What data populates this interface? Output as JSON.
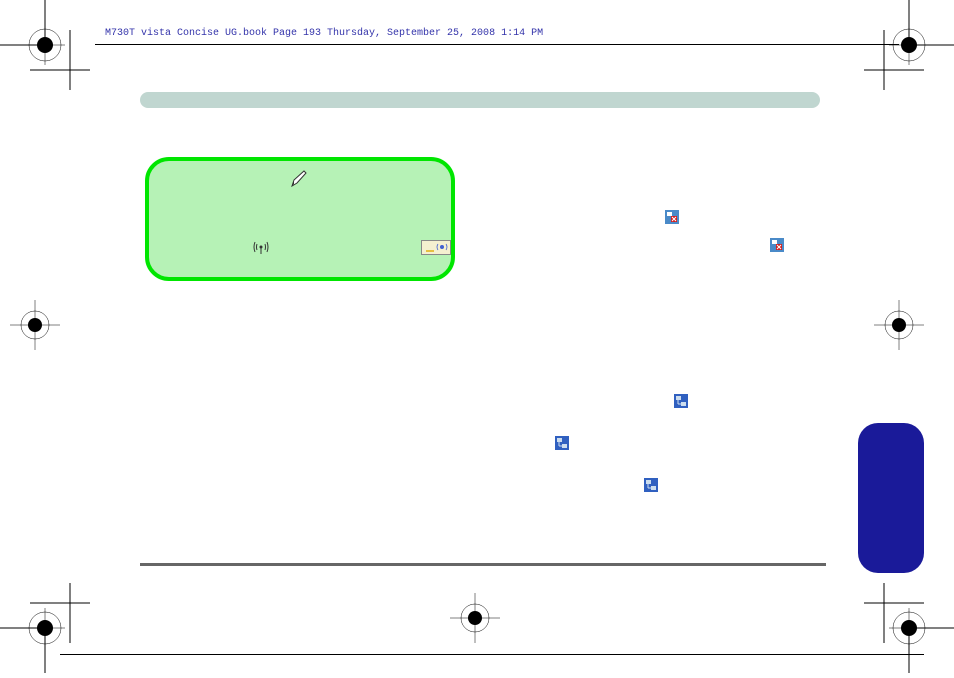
{
  "header": {
    "book_info": "M730T vista Concise UG.book  Page 193  Thursday, September 25, 2008  1:14 PM"
  },
  "icons": {
    "pen": "pen-icon",
    "antenna": "antenna-icon",
    "wlan": "wlan-switch-icon",
    "red1": "network-disconnected-icon",
    "red2": "network-disconnected-icon",
    "blue1": "network-connected-icon",
    "blue2": "network-connected-icon",
    "blue3": "network-connected-icon"
  }
}
